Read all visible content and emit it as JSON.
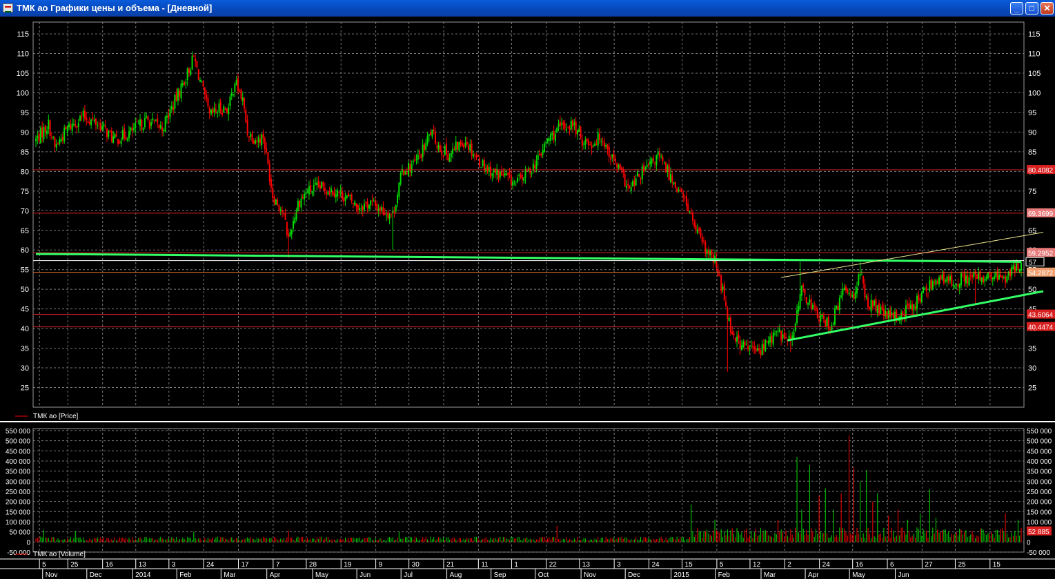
{
  "window": {
    "title": "ТМК ао Графики цены и объема - [Дневной]",
    "minimize_glyph": "_",
    "maximize_glyph": "□",
    "close_glyph": "✕"
  },
  "colors": {
    "background": "#000000",
    "up_candle": "#00dd00",
    "down_candle": "#ff0000",
    "grid": "#7a7a7a",
    "trend_green": "#33ff66",
    "trend_yellow": "#f0e890",
    "level_red": "#d92020",
    "level_orange": "#e0702a"
  },
  "chart_data": [
    {
      "type": "candlestick",
      "legend": "ТМК ао [Price]",
      "ylim": [
        20,
        118
      ],
      "y_ticks": [
        25,
        30,
        35,
        40,
        45,
        50,
        55,
        60,
        65,
        70,
        75,
        80,
        85,
        90,
        95,
        100,
        105,
        110,
        115
      ],
      "grid": true,
      "price_anchors": [
        [
          0,
          88
        ],
        [
          8,
          92
        ],
        [
          12,
          86
        ],
        [
          20,
          91
        ],
        [
          30,
          94
        ],
        [
          40,
          92
        ],
        [
          50,
          88
        ],
        [
          60,
          90
        ],
        [
          70,
          93
        ],
        [
          80,
          91
        ],
        [
          87,
          97
        ],
        [
          95,
          104
        ],
        [
          100,
          109
        ],
        [
          106,
          100
        ],
        [
          110,
          94
        ],
        [
          116,
          96
        ],
        [
          122,
          96
        ],
        [
          126,
          103
        ],
        [
          131,
          98
        ],
        [
          134,
          90
        ],
        [
          140,
          88
        ],
        [
          144,
          89
        ],
        [
          150,
          74
        ],
        [
          156,
          70
        ],
        [
          160,
          63
        ],
        [
          166,
          72
        ],
        [
          172,
          75
        ],
        [
          180,
          76
        ],
        [
          190,
          75
        ],
        [
          198,
          73
        ],
        [
          204,
          71
        ],
        [
          212,
          72
        ],
        [
          220,
          70
        ],
        [
          226,
          69
        ],
        [
          232,
          80
        ],
        [
          240,
          82
        ],
        [
          246,
          86
        ],
        [
          250,
          90
        ],
        [
          256,
          86
        ],
        [
          262,
          84
        ],
        [
          266,
          86
        ],
        [
          272,
          88
        ],
        [
          280,
          83
        ],
        [
          288,
          80
        ],
        [
          296,
          79
        ],
        [
          304,
          77
        ],
        [
          312,
          80
        ],
        [
          318,
          83
        ],
        [
          324,
          88
        ],
        [
          332,
          91
        ],
        [
          340,
          92
        ],
        [
          346,
          88
        ],
        [
          352,
          87
        ],
        [
          358,
          89
        ],
        [
          364,
          84
        ],
        [
          370,
          80
        ],
        [
          376,
          75
        ],
        [
          382,
          79
        ],
        [
          388,
          81
        ],
        [
          394,
          84
        ],
        [
          400,
          80
        ],
        [
          406,
          76
        ],
        [
          412,
          72
        ],
        [
          418,
          65
        ],
        [
          424,
          60
        ],
        [
          430,
          57
        ],
        [
          436,
          48
        ],
        [
          440,
          40
        ],
        [
          446,
          36
        ],
        [
          452,
          35
        ],
        [
          458,
          34
        ],
        [
          464,
          37
        ],
        [
          470,
          39
        ],
        [
          476,
          37
        ],
        [
          480,
          38
        ],
        [
          484,
          50
        ],
        [
          488,
          48
        ],
        [
          494,
          44
        ],
        [
          498,
          42
        ],
        [
          504,
          41
        ],
        [
          508,
          46
        ],
        [
          512,
          50
        ],
        [
          518,
          49
        ],
        [
          522,
          54
        ],
        [
          526,
          47
        ],
        [
          530,
          46
        ],
        [
          536,
          44
        ],
        [
          540,
          43
        ],
        [
          546,
          43
        ],
        [
          552,
          45
        ],
        [
          558,
          47
        ],
        [
          564,
          50
        ],
        [
          570,
          53
        ],
        [
          576,
          52
        ],
        [
          582,
          52
        ],
        [
          590,
          53
        ],
        [
          598,
          53
        ],
        [
          606,
          53
        ],
        [
          614,
          53
        ],
        [
          620,
          55
        ],
        [
          624,
          57
        ]
      ],
      "spikes": [
        {
          "bar": 160,
          "low": 58
        },
        {
          "bar": 226,
          "low": 60
        },
        {
          "bar": 438,
          "low": 29
        },
        {
          "bar": 478,
          "low": 34
        },
        {
          "bar": 484,
          "high": 57
        },
        {
          "bar": 522,
          "high": 57
        },
        {
          "bar": 595,
          "low": 46
        }
      ],
      "horizontal_levels": [
        {
          "value": 80.4082,
          "label": "80.4082",
          "color": "#d92020",
          "label_bg": "#d92020"
        },
        {
          "value": 69.3699,
          "label": "69.3699",
          "color": "#d92020",
          "label_bg": "#e87a7a"
        },
        {
          "value": 59.2952,
          "label": "59.2952",
          "color": "#d92020",
          "label_bg": "#e87a7a"
        },
        {
          "value": 54.2872,
          "label": "54.2872",
          "color": "#e0702a",
          "label_bg": "#f0a070"
        },
        {
          "value": 43.6064,
          "label": "43.6064",
          "color": "#d92020",
          "label_bg": "#d92020"
        },
        {
          "value": 40.4474,
          "label": "40.4474",
          "color": "#d92020",
          "label_bg": "#d92020"
        },
        {
          "value": 57.3,
          "label": "",
          "color": "#ffffff",
          "label_bg": ""
        }
      ],
      "trend_lines": [
        {
          "color": "#33ff66",
          "width": 3,
          "from": [
            0,
            59.0
          ],
          "to": [
            624,
            57.0
          ]
        },
        {
          "color": "#33ff66",
          "width": 3,
          "from": [
            476,
            37.0
          ],
          "to": [
            648,
            49.5
          ]
        },
        {
          "color": "#f0e890",
          "width": 1,
          "from": [
            472,
            53.0
          ],
          "to": [
            648,
            64.5
          ]
        }
      ],
      "current_price_marker": "57"
    },
    {
      "type": "bar",
      "legend": "ТМК ао [Volume]",
      "ylim": [
        -50000,
        560000
      ],
      "y_ticks": [
        -50000,
        0,
        50000,
        100000,
        150000,
        200000,
        250000,
        300000,
        350000,
        400000,
        450000,
        500000,
        550000
      ],
      "y_tick_labels": [
        "-50 000",
        "0",
        "50 000",
        "100 000",
        "150 000",
        "200 000",
        "250 000",
        "300 000",
        "350 000",
        "400 000",
        "450 000",
        "500 000",
        "550 000"
      ],
      "base_volume": 22000,
      "active_from_bar": 415,
      "active_volume": 60000,
      "spikes": [
        [
          5,
          60000
        ],
        [
          25,
          55000
        ],
        [
          100,
          50000
        ],
        [
          160,
          55000
        ],
        [
          230,
          50000
        ],
        [
          330,
          80000
        ],
        [
          415,
          185000
        ],
        [
          430,
          110000
        ],
        [
          456,
          65000
        ],
        [
          470,
          110000
        ],
        [
          482,
          420000
        ],
        [
          485,
          160000
        ],
        [
          490,
          380000
        ],
        [
          496,
          230000
        ],
        [
          500,
          265000
        ],
        [
          505,
          160000
        ],
        [
          510,
          240000
        ],
        [
          515,
          525000
        ],
        [
          518,
          370000
        ],
        [
          522,
          300000
        ],
        [
          526,
          355000
        ],
        [
          530,
          200000
        ],
        [
          533,
          240000
        ],
        [
          540,
          130000
        ],
        [
          546,
          160000
        ],
        [
          552,
          110000
        ],
        [
          560,
          140000
        ],
        [
          566,
          260000
        ],
        [
          570,
          120000
        ],
        [
          585,
          65000
        ],
        [
          600,
          60000
        ],
        [
          608,
          60000
        ],
        [
          614,
          140000
        ],
        [
          622,
          110000
        ]
      ],
      "current_volume_label": "52 885"
    }
  ],
  "x_axis": {
    "days": [
      {
        "label": "5",
        "bar": 4
      },
      {
        "label": "25",
        "bar": 22
      },
      {
        "label": "16",
        "bar": 44
      },
      {
        "label": "13",
        "bar": 65
      },
      {
        "label": "3",
        "bar": 86
      },
      {
        "label": "24",
        "bar": 108
      },
      {
        "label": "17",
        "bar": 130
      },
      {
        "label": "7",
        "bar": 152
      },
      {
        "label": "28",
        "bar": 173
      },
      {
        "label": "19",
        "bar": 195
      },
      {
        "label": "9",
        "bar": 217
      },
      {
        "label": "30",
        "bar": 238
      },
      {
        "label": "21",
        "bar": 260
      },
      {
        "label": "11",
        "bar": 282
      },
      {
        "label": "1",
        "bar": 303
      },
      {
        "label": "22",
        "bar": 325
      },
      {
        "label": "13",
        "bar": 346
      },
      {
        "label": "3",
        "bar": 368
      },
      {
        "label": "24",
        "bar": 390
      },
      {
        "label": "15",
        "bar": 411
      },
      {
        "label": "5",
        "bar": 433
      },
      {
        "label": "12",
        "bar": 454
      },
      {
        "label": "2",
        "bar": 476
      },
      {
        "label": "24",
        "bar": 498
      },
      {
        "label": "16",
        "bar": 519
      },
      {
        "label": "6",
        "bar": 541
      },
      {
        "label": "27",
        "bar": 563
      },
      {
        "label": "25",
        "bar": 584
      },
      {
        "label": "15",
        "bar": 606
      }
    ],
    "months": [
      {
        "label": "Nov",
        "bar": 6
      },
      {
        "label": "Dec",
        "bar": 34
      },
      {
        "label": "2014",
        "bar": 63
      },
      {
        "label": "Feb",
        "bar": 91
      },
      {
        "label": "Mar",
        "bar": 119
      },
      {
        "label": "Apr",
        "bar": 148
      },
      {
        "label": "May",
        "bar": 177
      },
      {
        "label": "Jun",
        "bar": 205
      },
      {
        "label": "Jul",
        "bar": 233
      },
      {
        "label": "Aug",
        "bar": 262
      },
      {
        "label": "Sep",
        "bar": 290
      },
      {
        "label": "Oct",
        "bar": 318
      },
      {
        "label": "Nov",
        "bar": 347
      },
      {
        "label": "Dec",
        "bar": 375
      },
      {
        "label": "2015",
        "bar": 404
      },
      {
        "label": "Feb",
        "bar": 432
      },
      {
        "label": "Mar",
        "bar": 461
      },
      {
        "label": "Apr",
        "bar": 489
      },
      {
        "label": "May",
        "bar": 517
      },
      {
        "label": "Jun",
        "bar": 546
      }
    ]
  }
}
